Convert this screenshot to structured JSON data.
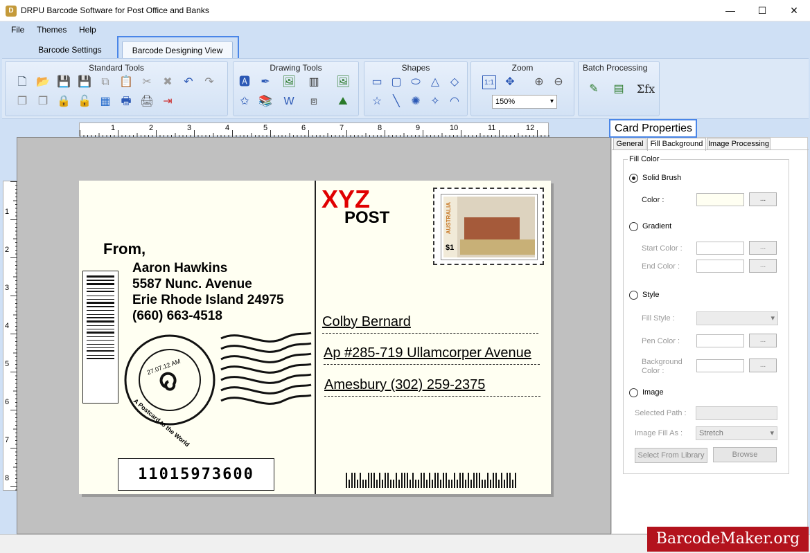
{
  "window": {
    "title": "DRPU Barcode Software for Post Office and Banks",
    "minimize": "—",
    "maximize": "☐",
    "close": "✕"
  },
  "menu": [
    {
      "label": "File",
      "key": "F"
    },
    {
      "label": "Themes",
      "key": "T"
    },
    {
      "label": "Help",
      "key": "H"
    }
  ],
  "tabs": {
    "settings": "Barcode Settings",
    "design": "Barcode Designing View"
  },
  "toolbar": {
    "standard_title": "Standard Tools",
    "drawing_title": "Drawing Tools",
    "shapes_title": "Shapes",
    "zoom_title": "Zoom",
    "zoom_value": "150%",
    "zoom_fit_label": "1:1",
    "batch_title": "Batch Processing",
    "batch_formula": "Σfx"
  },
  "ruler": {
    "h": [
      "1",
      "2",
      "3",
      "4",
      "5",
      "6",
      "7",
      "8",
      "9",
      "10",
      "11",
      "12"
    ],
    "v": [
      "1",
      "2",
      "3",
      "4",
      "5",
      "6",
      "7",
      "8"
    ]
  },
  "card": {
    "from_label": "From,",
    "sender": [
      "Aaron Hawkins",
      "5587 Nunc. Avenue",
      "Erie Rhode Island 24975",
      "(660) 663-4518"
    ],
    "brand_xyz": "XYZ",
    "brand_post": "POST",
    "recipient": [
      "Colby Bernard",
      "Ap #285-719 Ullamcorper Avenue",
      "Amesbury (302) 259-2375"
    ],
    "barcode_number": "11015973600",
    "stamp_country": "AUSTRALIA",
    "stamp_value": "$1",
    "postmark_date": "27.07.12 AM",
    "postmark_text": "A Postcard to the World"
  },
  "props": {
    "title": "Card Properties",
    "tabs": [
      "General",
      "Fill Background",
      "Image Processing"
    ],
    "group": "Fill Color",
    "solid": "Solid Brush",
    "color_label": "Color :",
    "gradient": "Gradient",
    "start_color": "Start Color :",
    "end_color": "End Color :",
    "style": "Style",
    "fill_style": "Fill Style :",
    "pen_color": "Pen Color :",
    "bg_color_1": "Background",
    "bg_color_2": "Color :",
    "image": "Image",
    "selected_path": "Selected Path :",
    "image_fill_as": "Image Fill As :",
    "image_fill_value": "Stretch",
    "select_library": "Select From Library",
    "browse": "Browse",
    "dots": "..."
  },
  "watermark": "BarcodeMaker.org",
  "colors": {
    "accent": "#4a86e8",
    "card": "#fffff2",
    "xyz": "#e00000",
    "solid_color": "#fffff2"
  }
}
